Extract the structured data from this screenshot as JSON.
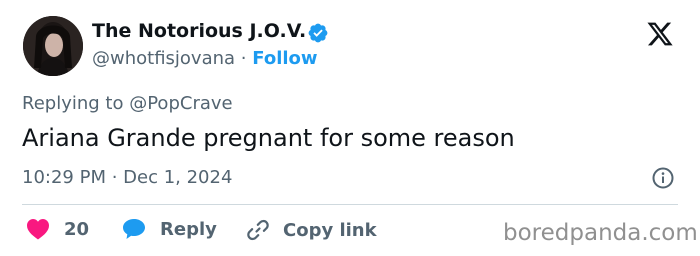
{
  "author": {
    "display_name": "The Notorious J.O.V.",
    "handle": "@whotfisjovana",
    "separator": "·",
    "follow_label": "Follow",
    "verified": true
  },
  "tweet": {
    "replying_prefix": "Replying to",
    "replying_to": "@PopCrave",
    "text": "Ariana Grande pregnant for some reason",
    "timestamp": "10:29 PM · Dec 1, 2024"
  },
  "actions": {
    "like_count": "20",
    "reply_label": "Reply",
    "copy_link_label": "Copy link"
  },
  "watermark": "boredpanda.com",
  "colors": {
    "accent": "#1d9bf0",
    "like": "#f91880",
    "secondary_text": "#536471",
    "primary_text": "#0f1419"
  },
  "icons": [
    "x-logo-icon",
    "verified-badge-icon",
    "info-icon",
    "heart-icon",
    "reply-bubble-icon",
    "link-icon"
  ]
}
